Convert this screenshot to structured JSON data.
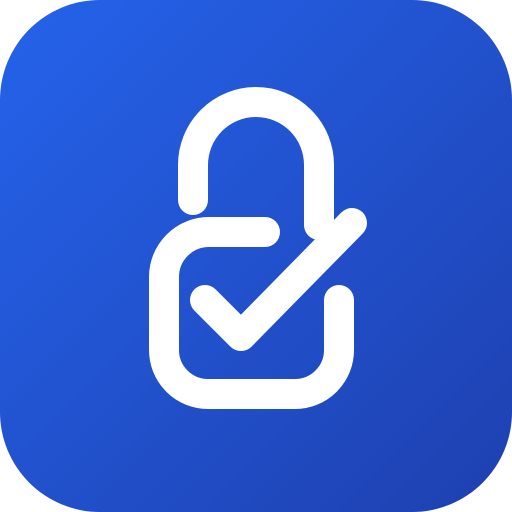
{
  "icon": {
    "name": "lock-check-icon",
    "colors": {
      "gradient_start": "#2563EB",
      "gradient_end": "#1E40AF",
      "glyph": "#FFFFFF"
    }
  }
}
